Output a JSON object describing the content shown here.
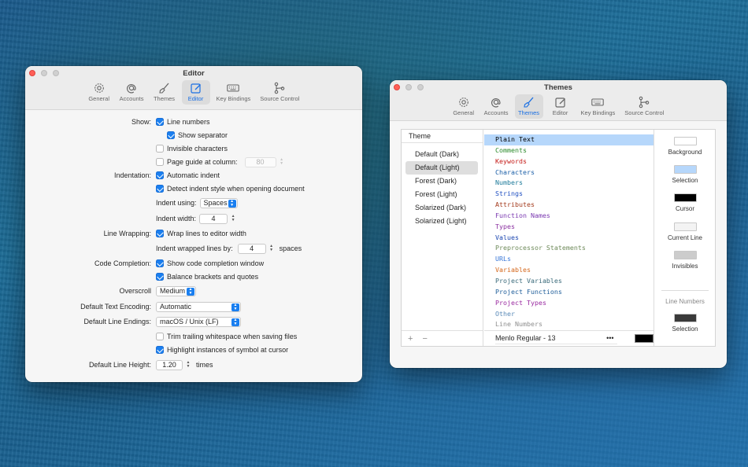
{
  "colors": {
    "accent": "#1a7ff0",
    "close_button": "#ff5f57",
    "selection_highlight": "#b6d7fb"
  },
  "toolbar_items": [
    {
      "label": "General",
      "icon": "gear-icon"
    },
    {
      "label": "Accounts",
      "icon": "at-sign-icon"
    },
    {
      "label": "Themes",
      "icon": "paintbrush-icon"
    },
    {
      "label": "Editor",
      "icon": "edit-pencil-icon"
    },
    {
      "label": "Key Bindings",
      "icon": "keyboard-icon"
    },
    {
      "label": "Source Control",
      "icon": "branch-icon"
    }
  ],
  "editor_window": {
    "title": "Editor",
    "active_tab": "Editor",
    "show_label": "Show:",
    "line_numbers": {
      "label": "Line numbers",
      "checked": true
    },
    "show_separator": {
      "label": "Show separator",
      "checked": true
    },
    "invisible_characters": {
      "label": "Invisible characters",
      "checked": false
    },
    "page_guide": {
      "label": "Page guide at column:",
      "checked": false,
      "value": "80"
    },
    "indentation_label": "Indentation:",
    "automatic_indent": {
      "label": "Automatic indent",
      "checked": true
    },
    "detect_indent": {
      "label": "Detect indent style when opening document",
      "checked": true
    },
    "indent_using": {
      "label": "Indent using:",
      "value": "Spaces"
    },
    "indent_width": {
      "label": "Indent width:",
      "value": "4"
    },
    "line_wrapping_label": "Line Wrapping:",
    "wrap_lines": {
      "label": "Wrap lines to editor width",
      "checked": true
    },
    "indent_wrapped": {
      "label": "Indent wrapped lines by:",
      "value": "4",
      "suffix": "spaces"
    },
    "code_completion_label": "Code Completion:",
    "show_completion": {
      "label": "Show code completion window",
      "checked": true
    },
    "balance_brackets": {
      "label": "Balance brackets and quotes",
      "checked": true
    },
    "overscroll": {
      "label": "Overscroll",
      "value": "Medium"
    },
    "text_encoding": {
      "label": "Default Text Encoding:",
      "value": "Automatic"
    },
    "line_endings": {
      "label": "Default Line Endings:",
      "value": "macOS / Unix (LF)"
    },
    "trim_whitespace": {
      "label": "Trim trailing whitespace when saving files",
      "checked": false
    },
    "highlight_instances": {
      "label": "Highlight instances of symbol at cursor",
      "checked": true
    },
    "line_height": {
      "label": "Default Line Height:",
      "value": "1.20",
      "suffix": "times"
    }
  },
  "themes_window": {
    "title": "Themes",
    "active_tab": "Themes",
    "list_header": "Theme",
    "themes": [
      {
        "name": "Default (Dark)",
        "selected": false
      },
      {
        "name": "Default (Light)",
        "selected": true
      },
      {
        "name": "Forest (Dark)",
        "selected": false
      },
      {
        "name": "Forest (Light)",
        "selected": false
      },
      {
        "name": "Solarized (Dark)",
        "selected": false
      },
      {
        "name": "Solarized (Light)",
        "selected": false
      }
    ],
    "add_label": "+",
    "remove_label": "−",
    "code_items": [
      {
        "text": "Plain Text",
        "color": "#000000",
        "selected": true
      },
      {
        "text": "Comments",
        "color": "#2a8a2a"
      },
      {
        "text": "Keywords",
        "color": "#c41a16"
      },
      {
        "text": "Characters",
        "color": "#1c5fa8"
      },
      {
        "text": "Numbers",
        "color": "#1c7a9a"
      },
      {
        "text": "Strings",
        "color": "#1f4fc2"
      },
      {
        "text": "Attributes",
        "color": "#a33a1c"
      },
      {
        "text": "Function Names",
        "color": "#7a38b0"
      },
      {
        "text": "Types",
        "color": "#8a2fa0"
      },
      {
        "text": "Values",
        "color": "#1a45b0"
      },
      {
        "text": "Preprocessor Statements",
        "color": "#6e8a5a"
      },
      {
        "text": "URLs",
        "color": "#3a78d8"
      },
      {
        "text": "Variables",
        "color": "#d4661a"
      },
      {
        "text": "Project Variables",
        "color": "#3a6a7a"
      },
      {
        "text": "Project Functions",
        "color": "#1f5e9a"
      },
      {
        "text": "Project Types",
        "color": "#9a2aa0"
      },
      {
        "text": "Other",
        "color": "#5a8ab8"
      },
      {
        "text": "Line Numbers",
        "color": "#8f8f8f"
      }
    ],
    "font": {
      "value": "Menlo Regular - 13",
      "more": "•••",
      "color": "#000000"
    },
    "swatches": [
      {
        "label": "Background",
        "color": "#ffffff"
      },
      {
        "label": "Selection",
        "color": "#b6d7fb"
      },
      {
        "label": "Cursor",
        "color": "#000000"
      },
      {
        "label": "Current Line",
        "color": "#f3f3f3"
      },
      {
        "label": "Invisibles",
        "color": "#cccccc"
      }
    ],
    "line_numbers_section": "Line Numbers",
    "line_number_swatch": {
      "label": "Selection",
      "color": "#3a3a3a"
    }
  }
}
